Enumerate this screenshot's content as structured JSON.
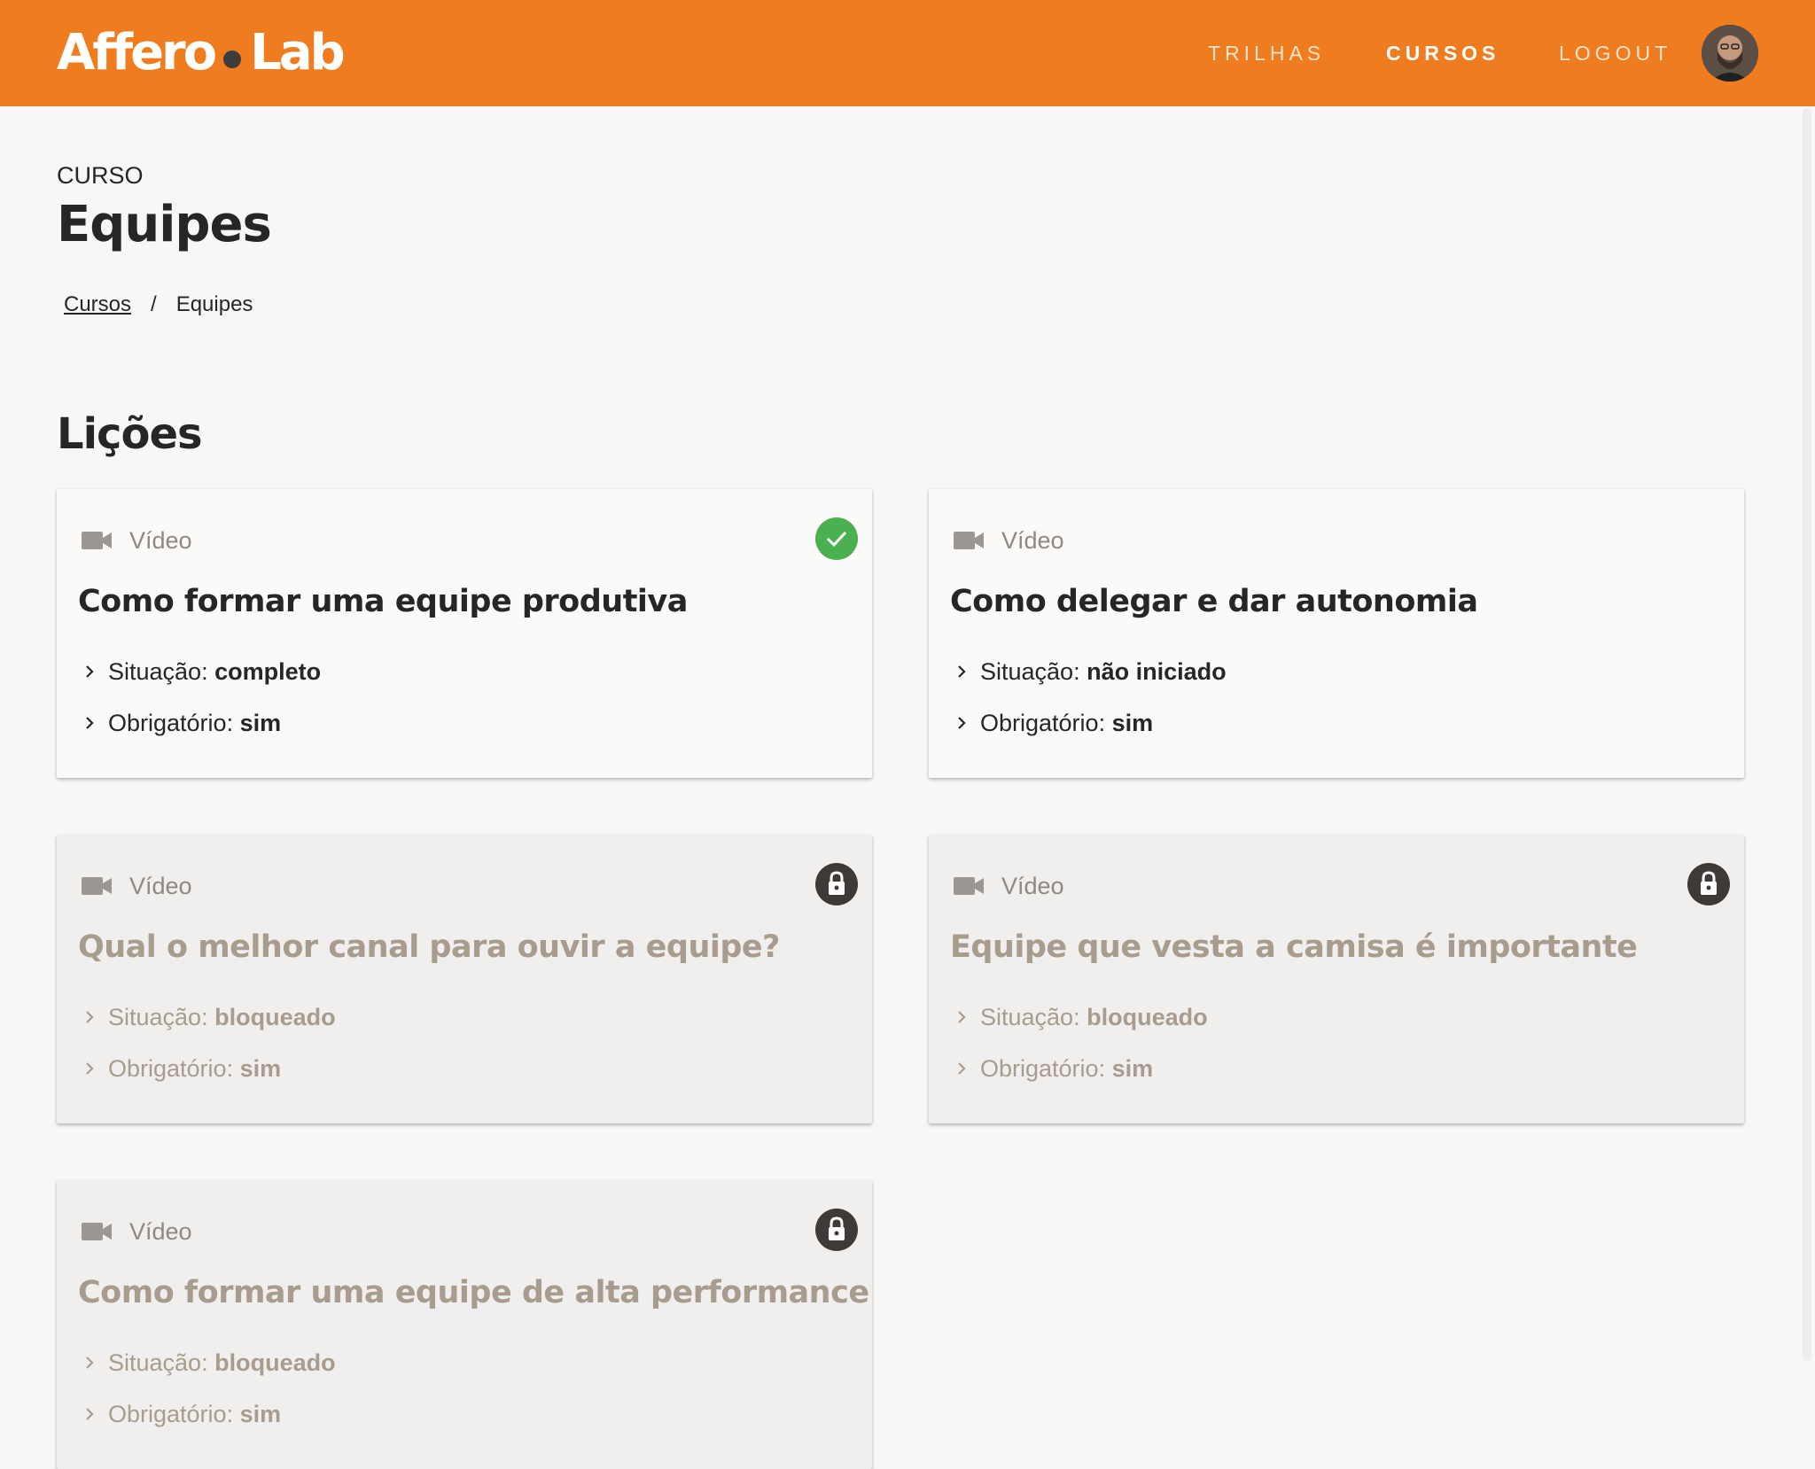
{
  "header": {
    "logo_left": "Affero",
    "logo_right": "Lab",
    "nav": [
      {
        "label": "TRILHAS",
        "active": false
      },
      {
        "label": "CURSOS",
        "active": true
      },
      {
        "label": "LOGOUT",
        "active": false
      }
    ]
  },
  "page": {
    "eyebrow": "CURSO",
    "title": "Equipes",
    "breadcrumb": {
      "link": "Cursos",
      "separator": "/",
      "current": "Equipes"
    },
    "section_title": "Lições"
  },
  "lessons": [
    {
      "type": "Vídeo",
      "title": "Como formar uma equipe produtiva",
      "status_label": "Situação:",
      "status": "completo",
      "required_label": "Obrigatório:",
      "required": "sim",
      "badge": "check-icon",
      "locked": false
    },
    {
      "type": "Vídeo",
      "title": "Como delegar e dar autonomia",
      "status_label": "Situação:",
      "status": "não iniciado",
      "required_label": "Obrigatório:",
      "required": "sim",
      "badge": null,
      "locked": false
    },
    {
      "type": "Vídeo",
      "title": "Qual o melhor canal para ouvir a equipe?",
      "status_label": "Situação:",
      "status": "bloqueado",
      "required_label": "Obrigatório:",
      "required": "sim",
      "badge": "lock-icon",
      "locked": true
    },
    {
      "type": "Vídeo",
      "title": "Equipe que vesta a camisa é importante",
      "status_label": "Situação:",
      "status": "bloqueado",
      "required_label": "Obrigatório:",
      "required": "sim",
      "badge": "lock-icon",
      "locked": true
    },
    {
      "type": "Vídeo",
      "title": "Como formar uma equipe de alta performance",
      "status_label": "Situação:",
      "status": "bloqueado",
      "required_label": "Obrigatório:",
      "required": "sim",
      "badge": "lock-icon",
      "locked": true
    }
  ],
  "colors": {
    "header_bg": "#ef7d20",
    "complete_green": "#4caf50",
    "lock_dark": "#3f3a37",
    "locked_text": "#a89c8e"
  }
}
